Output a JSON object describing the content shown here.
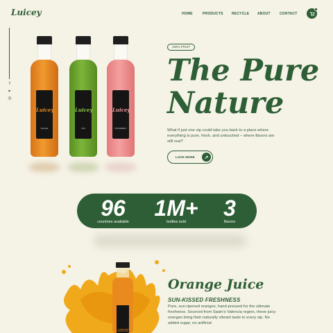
{
  "header": {
    "logo": "Luicey",
    "nav": [
      "HOME",
      "PRODUCTS",
      "RECYCLE",
      "ABOUT",
      "CONTACT"
    ],
    "cart_icon": "cart-icon"
  },
  "social": [
    "f",
    "▶",
    "◎"
  ],
  "hero": {
    "badge": "100% FRUIT",
    "title_line1": "The Pure",
    "title_line2": "Nature",
    "description": "What if just one sip could take you back to a place where everything is pure, fresh, and untouched – where flavors are still real?",
    "cta_label": "LOOK MORE",
    "cta_icon": "arrow-up-right-icon"
  },
  "bottles": [
    {
      "name": "ORANGE",
      "brand": "Luicey",
      "color": "#e98a1e"
    },
    {
      "name": "KIWI",
      "brand": "Luicey",
      "color": "#6aa12a"
    },
    {
      "name": "STRAWBERRY",
      "brand": "Luicey",
      "color": "#ee8a8a"
    }
  ],
  "stats": [
    {
      "value": "96",
      "label": "countries available"
    },
    {
      "value": "1M+",
      "label": "bottles sold"
    },
    {
      "value": "3",
      "label": "flavors"
    }
  ],
  "product": {
    "title": "Orange Juice",
    "subtitle": "SUN-KISSED FRESHNESS",
    "description": "Pure, sun-ripened oranges, hand-pressed for the ultimate freshness. Sourced from Spain's Valencia region, these juicy oranges bring their naturally vibrant taste to every sip. No added sugar, no artificial",
    "bottle_brand": "Luicey"
  },
  "colors": {
    "brand_green": "#2d5e35",
    "background": "#f5f2e6",
    "orange": "#e98a1e"
  }
}
